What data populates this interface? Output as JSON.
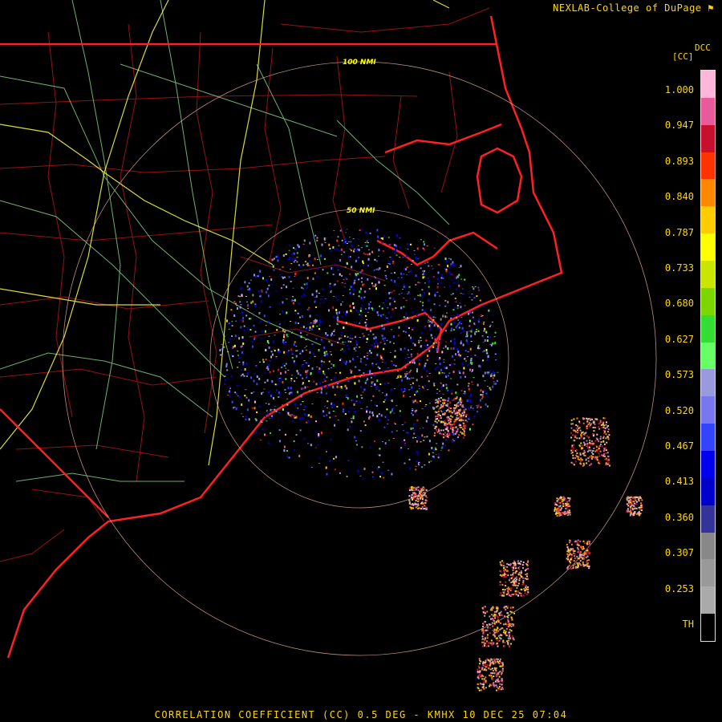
{
  "credit": {
    "text": "NEXLAB-College of DuPage"
  },
  "legend": {
    "title": "DCC",
    "unit": "[CC]",
    "ticks": [
      "1.000",
      "0.947",
      "0.893",
      "0.840",
      "0.787",
      "0.733",
      "0.680",
      "0.627",
      "0.573",
      "0.520",
      "0.467",
      "0.413",
      "0.360",
      "0.307",
      "0.253",
      "TH"
    ],
    "colors": [
      "#ffb6d9",
      "#e85a9a",
      "#c8102e",
      "#ff3300",
      "#ff8800",
      "#ffcc00",
      "#ffff00",
      "#c8e600",
      "#7cd600",
      "#33dd33",
      "#66ff66",
      "#9999dd",
      "#7777ee",
      "#3344ff",
      "#0000ee",
      "#0000cc",
      "#333399",
      "#888888",
      "#999999",
      "#aaaaaa",
      "#000000"
    ]
  },
  "rings": {
    "inner_label": "50 NMI",
    "outer_label": "100 NMI"
  },
  "caption": {
    "text": "CORRELATION COEFFICIENT (CC) 0.5 DEG - KMHX 10 DEC 25 07:04"
  },
  "colors": {
    "state_border": "#ff2020",
    "county": "#b41414",
    "highway_primary": "#ffff44",
    "highway_secondary": "#88dd88",
    "range_ring": "#e8b0a0"
  }
}
